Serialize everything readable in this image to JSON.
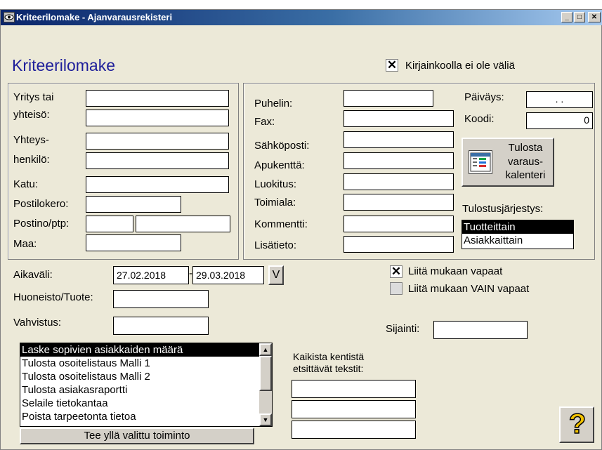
{
  "window": {
    "title": "Kriteerilomake - Ajanvarausrekisteri"
  },
  "heading": "Kriteerilomake",
  "case_option": {
    "label": "Kirjainkoolla ei ole väliä",
    "checked": true
  },
  "left_fields": {
    "yritys_label_1": "Yritys tai",
    "yritys_label_2": "yhteisö:",
    "yhteys_label_1": "Yhteys-",
    "yhteys_label_2": "henkilö:",
    "katu": "Katu:",
    "postilokero": "Postilokero:",
    "postino": "Postino/ptp:",
    "maa": "Maa:"
  },
  "mid_fields": {
    "puhelin": "Puhelin:",
    "fax": "Fax:",
    "sahkoposti": "Sähköposti:",
    "apukentta": "Apukenttä:",
    "luokitus": "Luokitus:",
    "toimiala": "Toimiala:",
    "kommentti": "Kommentti:",
    "lisatieto": "Lisätieto:"
  },
  "right_fields": {
    "paivays_label": "Päiväys:",
    "paivays_value": ". .",
    "koodi_label": "Koodi:",
    "koodi_value": "0"
  },
  "print_calendar_button": {
    "line1": "Tulosta",
    "line2": "varaus-",
    "line3": "kalenteri"
  },
  "sort_order": {
    "label": "Tulostusjärjestys:",
    "options": [
      "Tuotteittain",
      "Asiakkaittain"
    ],
    "selected": "Tuotteittain"
  },
  "period": {
    "label": "Aikaväli:",
    "start": "27.02.2018",
    "separator": "-",
    "end": "29.03.2018",
    "v_button": "V"
  },
  "product_label": "Huoneisto/Tuote:",
  "confirmation_label": "Vahvistus:",
  "include_free": {
    "label": "Liitä mukaan vapaat",
    "checked": true
  },
  "include_only_free": {
    "label": "Liitä mukaan VAIN vapaat",
    "checked": false
  },
  "location_label": "Sijainti:",
  "actions_list": {
    "items": [
      "Laske sopivien asiakkaiden määrä",
      "Tulosta osoitelistaus Malli 1",
      "Tulosta osoitelistaus Malli 2",
      "Tulosta asiakasraportti",
      "Selaile tietokantaa",
      "Poista tarpeetonta tietoa"
    ],
    "selected": "Laske sopivien asiakkaiden määrä"
  },
  "run_action_button": "Tee yllä valittu toiminto",
  "all_fields_search": {
    "label_1": "Kaikista kentistä",
    "label_2": "etsittävät tekstit:"
  },
  "help_button": {
    "glyph": "?"
  }
}
